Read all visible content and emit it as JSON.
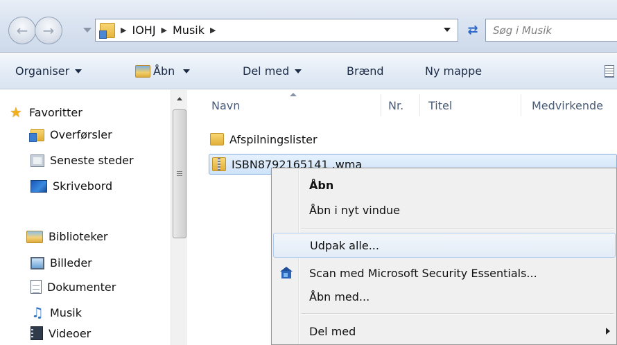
{
  "address_bar": {
    "breadcrumbs": [
      "IOHJ",
      "Musik"
    ],
    "search_placeholder": "Søg i Musik"
  },
  "toolbar": {
    "organize": "Organiser",
    "open": "Åbn",
    "share": "Del med",
    "burn": "Brænd",
    "new_folder": "Ny mappe"
  },
  "nav_pane": {
    "favorites": {
      "title": "Favoritter",
      "items": [
        {
          "label": "Overførsler",
          "icon": "downloads-icon"
        },
        {
          "label": "Seneste steder",
          "icon": "recent-places-icon"
        },
        {
          "label": "Skrivebord",
          "icon": "desktop-icon"
        }
      ]
    },
    "libraries": {
      "title": "Biblioteker",
      "items": [
        {
          "label": "Billeder",
          "icon": "pictures-icon"
        },
        {
          "label": "Dokumenter",
          "icon": "documents-icon"
        },
        {
          "label": "Musik",
          "icon": "music-icon"
        },
        {
          "label": "Videoer",
          "icon": "videos-icon"
        }
      ]
    }
  },
  "file_list": {
    "columns": [
      "Navn",
      "Nr.",
      "Titel",
      "Medvirkende"
    ],
    "items": [
      {
        "name": "Afspilningslister",
        "type": "folder",
        "selected": false
      },
      {
        "name": "ISBN8792165141 .wma",
        "type": "compressed-folder",
        "selected": true
      }
    ]
  },
  "context_menu": {
    "items": [
      {
        "label": "Åbn",
        "bold": true
      },
      {
        "label": "Åbn i nyt vindue"
      },
      {
        "label": "Udpak alle...",
        "hover": true
      },
      {
        "label": "Scan med Microsoft Security Essentials...",
        "icon": "security-essentials-icon"
      },
      {
        "label": "Åbn med..."
      },
      {
        "label": "Del med",
        "submenu": true
      }
    ]
  },
  "colors": {
    "selection_fill": "#cfe3f9",
    "selection_border": "#84acdd",
    "menu_background": "#f0f0f0"
  }
}
